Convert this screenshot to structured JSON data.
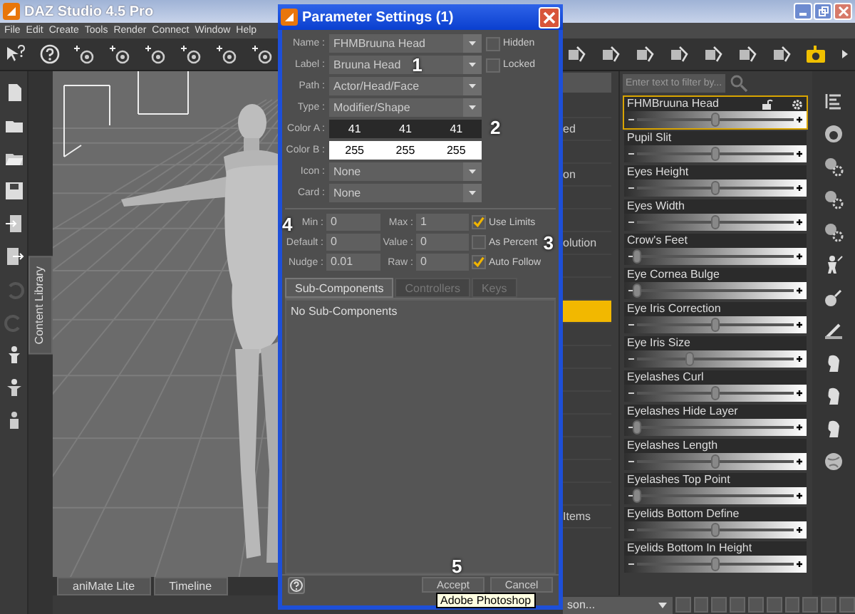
{
  "window": {
    "title": "DAZ Studio 4.5 Pro"
  },
  "menu": [
    "File",
    "Edit",
    "Create",
    "Tools",
    "Render",
    "Connect",
    "Window",
    "Help"
  ],
  "side_tab": {
    "label": "Content Library"
  },
  "viewport_tabs": [
    {
      "label": "aniMate Lite"
    },
    {
      "label": "Timeline"
    }
  ],
  "scene_list": {
    "rows": [
      {
        "selected": false
      },
      {
        "text": "ed",
        "selected": false
      },
      {
        "selected": false
      },
      {
        "text": "on",
        "selected": false
      },
      {
        "selected": false
      },
      {
        "selected": false
      },
      {
        "text": "olution",
        "selected": false
      },
      {
        "selected": false
      },
      {
        "selected": false
      },
      {
        "selected": true
      },
      {
        "selected": false
      },
      {
        "selected": false
      },
      {
        "selected": false
      },
      {
        "selected": false
      },
      {
        "selected": false
      },
      {
        "selected": false
      },
      {
        "selected": false
      },
      {
        "selected": false
      },
      {
        "text": "Items",
        "selected": false
      }
    ]
  },
  "parameters": {
    "filter": {
      "placeholder": "Enter text to filter by..."
    },
    "sliders": [
      {
        "label": "FHMBruuna Head",
        "level": 0.5,
        "selected": true
      },
      {
        "label": "Pupil Slit",
        "level": 0.5,
        "selected": false
      },
      {
        "label": "Eyes Height",
        "level": 0.5,
        "selected": false
      },
      {
        "label": "Eyes Width",
        "level": 0.5,
        "selected": false
      },
      {
        "label": "Crow's Feet",
        "level": 0,
        "selected": false
      },
      {
        "label": "Eye Cornea Bulge",
        "level": 0,
        "selected": false
      },
      {
        "label": "Eye Iris Correction",
        "level": 0.5,
        "selected": false
      },
      {
        "label": "Eye Iris Size",
        "level": 0.34,
        "selected": false
      },
      {
        "label": "Eyelashes Curl",
        "level": 0.5,
        "selected": false
      },
      {
        "label": "Eyelashes Hide Layer",
        "level": 0,
        "selected": false
      },
      {
        "label": "Eyelashes Length",
        "level": 0.5,
        "selected": false
      },
      {
        "label": "Eyelashes Top Point",
        "level": 0,
        "selected": false
      },
      {
        "label": "Eyelids Bottom Define",
        "level": 0.5,
        "selected": false
      },
      {
        "label": "Eyelids Bottom In Height",
        "level": 0.5,
        "selected": false
      }
    ]
  },
  "bottom_combo": {
    "value": "son..."
  },
  "dialog": {
    "title": "Parameter Settings (1)",
    "fields": [
      {
        "kind": "dropdown",
        "label": "Name :",
        "value": "FHMBruuna Head"
      },
      {
        "kind": "dropdown",
        "label": "Label :",
        "value": "Bruuna Head"
      },
      {
        "kind": "dropdown",
        "label": "Path :",
        "value": "Actor/Head/Face"
      },
      {
        "kind": "dropdown",
        "label": "Type :",
        "value": "Modifier/Shape"
      },
      {
        "kind": "color",
        "label": "Color A :",
        "values": [
          "41",
          "41",
          "41"
        ]
      },
      {
        "kind": "color",
        "label": "Color B :",
        "values": [
          "255",
          "255",
          "255"
        ]
      },
      {
        "kind": "dropdown",
        "label": "Icon :",
        "value": "None"
      },
      {
        "kind": "dropdown",
        "label": "Card :",
        "value": "None"
      }
    ],
    "flags": [
      {
        "label": "Hidden",
        "checked": false
      },
      {
        "label": "Locked",
        "checked": false
      }
    ],
    "limits": [
      {
        "label": "Min :",
        "value": "0"
      },
      {
        "label": "Max :",
        "value": "1"
      },
      {
        "label": "Default :",
        "value": "0"
      },
      {
        "label": "Value :",
        "value": "0"
      },
      {
        "label": "Nudge :",
        "value": "0.01"
      },
      {
        "label": "Raw :",
        "value": "0"
      }
    ],
    "options": [
      {
        "label": "Use Limits",
        "checked": true
      },
      {
        "label": "As Percent",
        "checked": false
      },
      {
        "label": "Auto Follow",
        "checked": true
      }
    ],
    "tabs": [
      {
        "label": "Sub-Components",
        "selected": true
      },
      {
        "label": "Controllers",
        "selected": false
      },
      {
        "label": "Keys",
        "selected": false
      }
    ],
    "empty_text": "No Sub-Components",
    "buttons": [
      {
        "label": "Accept"
      },
      {
        "label": "Cancel"
      }
    ]
  },
  "annotations": [
    "1",
    "2",
    "3",
    "4",
    "5"
  ],
  "tooltip": "Adobe Photoshop"
}
